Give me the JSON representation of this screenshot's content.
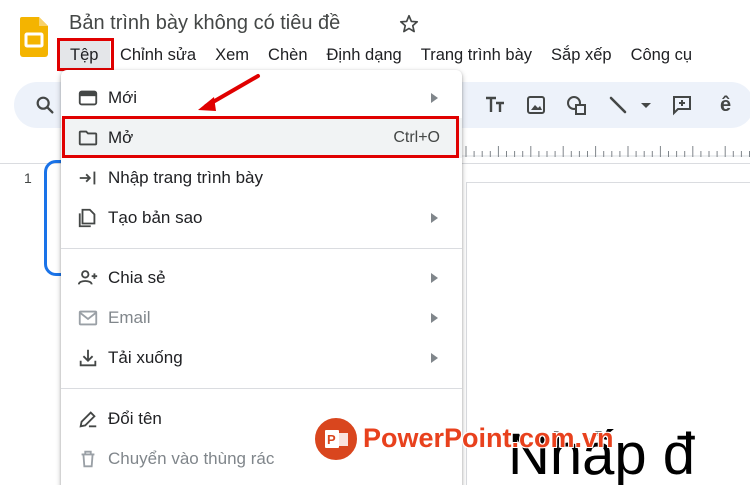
{
  "header": {
    "title": "Bản trình bày không có tiêu đề",
    "star_icon": "star-icon",
    "logo_icon": "slides-logo-icon"
  },
  "menubar": {
    "items": [
      "Tệp",
      "Chỉnh sửa",
      "Xem",
      "Chèn",
      "Định dạng",
      "Trang trình bày",
      "Sắp xếp",
      "Công cụ"
    ]
  },
  "toolbar": {
    "icons": [
      "search-icon",
      "text-style-icon",
      "image-icon",
      "shape-icon",
      "line-icon",
      "dropdown-caret-icon",
      "add-comment-icon",
      "input-tools-icon"
    ],
    "partial_glyph": "ê"
  },
  "slides": {
    "number": "1"
  },
  "slide_canvas": {
    "text": "Nhấp đ"
  },
  "file_menu": {
    "items": [
      {
        "label": "Mới",
        "icon": "new-slide-icon",
        "submenu": true
      },
      {
        "label": "Mở",
        "icon": "folder-icon",
        "shortcut": "Ctrl+O"
      },
      {
        "label": "Nhập trang trình bày",
        "icon": "import-icon"
      },
      {
        "label": "Tạo bản sao",
        "icon": "copy-icon",
        "submenu": true
      },
      {
        "label": "Chia sẻ",
        "icon": "share-person-icon",
        "submenu": true
      },
      {
        "label": "Email",
        "icon": "email-icon",
        "submenu": true,
        "disabled": true
      },
      {
        "label": "Tải xuống",
        "icon": "download-icon",
        "submenu": true
      },
      {
        "label": "Đổi tên",
        "icon": "rename-icon"
      },
      {
        "label": "Chuyển vào thùng rác",
        "icon": "trash-icon",
        "disabled": true
      }
    ]
  },
  "watermark": {
    "text": "PowerPoint.com.vn",
    "logo": "powerpoint-logo-icon"
  },
  "colors": {
    "highlight": "#e00000",
    "accent_blue": "#1a73e8",
    "slides_yellow": "#f4b400",
    "watermark_orange": "#e8411d"
  }
}
